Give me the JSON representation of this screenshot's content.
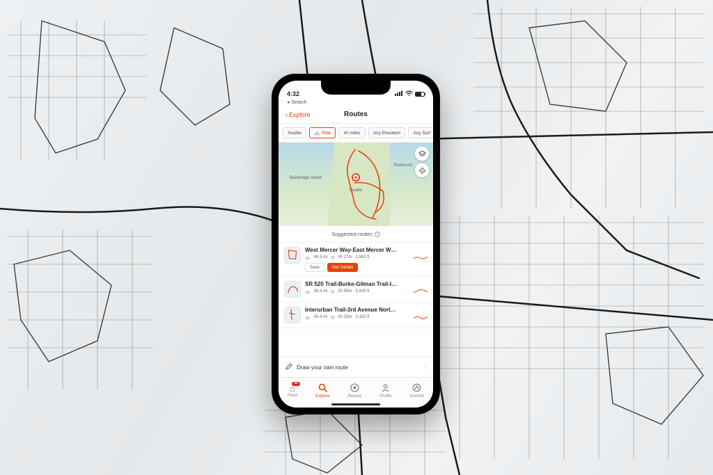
{
  "status_bar": {
    "time": "4:32",
    "return_to": "Search"
  },
  "nav": {
    "back_label": "Explore",
    "title": "Routes"
  },
  "filters": [
    {
      "label": "Seattle"
    },
    {
      "label": "Ride",
      "active": true,
      "icon": true
    },
    {
      "label": "40 miles"
    },
    {
      "label": "Any Elevation"
    },
    {
      "label": "Any Surf"
    }
  ],
  "map": {
    "center_label": "Seattle",
    "poi_left": "Bainbridge Island",
    "poi_right": "Redmond"
  },
  "suggested_label": "Suggested routes",
  "routes": [
    {
      "title": "West Mercer Way-East Mercer W…",
      "distance": "46.3 mi",
      "duration": "3h 27m",
      "elevation": "1,682 ft",
      "expanded": true,
      "save_label": "Save",
      "details_label": "See Details"
    },
    {
      "title": "SR 520 Trail-Burke-Gilman Trail-I…",
      "distance": "39.3 mi",
      "duration": "2h 55m",
      "elevation": "2,429 ft"
    },
    {
      "title": "Interurban Trail-3rd Avenue Nort…",
      "distance": "34.4 mi",
      "duration": "2h 25m",
      "elevation": "2,162 ft"
    }
  ],
  "draw_label": "Draw your own route",
  "tabs": {
    "feed": "Feed",
    "explore": "Explore",
    "record": "Record",
    "profile": "Profile",
    "summit": "Summit",
    "feed_badge": "31"
  },
  "colors": {
    "accent": "#e34402"
  }
}
